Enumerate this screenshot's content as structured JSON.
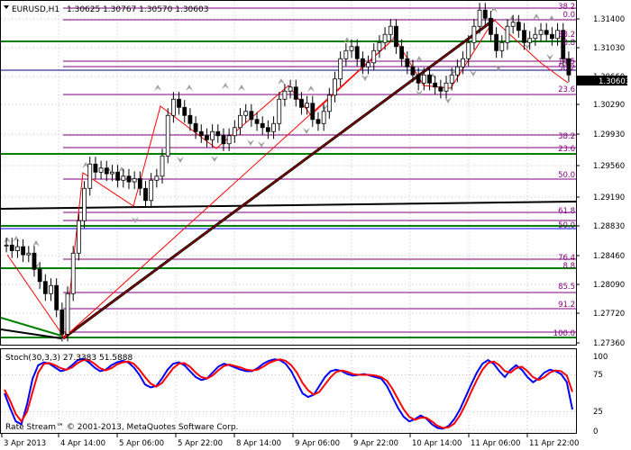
{
  "header": {
    "symbol": "EURUSD,H1",
    "ohlc": "1.30625 1.30767 1.30570 1.30603"
  },
  "indicator": {
    "label": "Stoch(30,3,3) 27.3383 51.5888",
    "levels": [
      "100",
      "75",
      "25",
      "0"
    ],
    "main_values": [
      50,
      30,
      12,
      8,
      35,
      70,
      88,
      92,
      90,
      85,
      80,
      82,
      88,
      95,
      97,
      92,
      85,
      80,
      82,
      88,
      92,
      94,
      92,
      85,
      75,
      62,
      58,
      60,
      70,
      82,
      90,
      92,
      88,
      80,
      72,
      68,
      70,
      78,
      86,
      90,
      88,
      85,
      82,
      80,
      80,
      84,
      90,
      94,
      96,
      95,
      90,
      80,
      65,
      50,
      45,
      48,
      60,
      72,
      80,
      82,
      80,
      76,
      74,
      75,
      76,
      74,
      72,
      70,
      60,
      45,
      30,
      18,
      12,
      15,
      20,
      16,
      8,
      3,
      2,
      6,
      15,
      28,
      45,
      62,
      78,
      90,
      95,
      90,
      80,
      72,
      82,
      88,
      82,
      72,
      65,
      70,
      78,
      82,
      80,
      76,
      65,
      28
    ],
    "signal_values": [
      55,
      40,
      22,
      12,
      25,
      52,
      78,
      90,
      91,
      88,
      84,
      82,
      85,
      91,
      95,
      95,
      90,
      84,
      81,
      84,
      89,
      92,
      93,
      90,
      82,
      72,
      63,
      59,
      64,
      74,
      84,
      90,
      91,
      86,
      78,
      72,
      70,
      74,
      81,
      87,
      89,
      87,
      85,
      82,
      81,
      82,
      86,
      91,
      94,
      96,
      94,
      88,
      78,
      64,
      54,
      48,
      52,
      62,
      72,
      79,
      81,
      79,
      76,
      75,
      75,
      75,
      74,
      72,
      67,
      56,
      42,
      28,
      18,
      14,
      17,
      17,
      12,
      6,
      3,
      4,
      9,
      20,
      35,
      52,
      68,
      82,
      91,
      93,
      88,
      80,
      78,
      84,
      86,
      80,
      72,
      68,
      72,
      78,
      81,
      80,
      74,
      52
    ],
    "colors": {
      "main": "#0000ff",
      "signal": "#ff0000"
    }
  },
  "copyright": "Rate Stream™ © 2001-2013, MetaQuotes Software Corp.",
  "price_axis": {
    "ticks": [
      "1.31400",
      "1.31030",
      "1.30660",
      "1.30290",
      "1.29930",
      "1.29560",
      "1.29190",
      "1.28830",
      "1.28460",
      "1.28090",
      "1.27720",
      "1.27360"
    ],
    "current": "1.30603"
  },
  "time_axis": {
    "ticks": [
      "3 Apr 2013",
      "4 Apr 14:00",
      "5 Apr 06:00",
      "5 Apr 22:00",
      "8 Apr 14:00",
      "9 Apr 06:00",
      "9 Apr 22:00",
      "10 Apr 14:00",
      "11 Apr 06:00",
      "11 Apr 22:00"
    ]
  },
  "fibo_right": {
    "labels": [
      "38.2",
      "0.0",
      "38.2",
      "8.8",
      "14.5",
      "56.2",
      "23.6"
    ]
  },
  "fibo_mid": {
    "labels": [
      "38.2",
      "23.6",
      "50.0",
      "61.8",
      "50.0",
      "76.4",
      "8.8",
      "85.5",
      "91.2",
      "100.0"
    ]
  },
  "candles": [
    1.285,
    1.2843,
    1.2848,
    1.2838,
    1.284,
    1.282,
    1.2805,
    1.279,
    1.28,
    1.277,
    1.274,
    1.279,
    1.284,
    1.288,
    1.292,
    1.295,
    1.294,
    1.2945,
    1.2938,
    1.294,
    1.293,
    1.2935,
    1.2928,
    1.2932,
    1.292,
    1.2905,
    1.293,
    1.2935,
    1.296,
    1.301,
    1.303,
    1.302,
    1.301,
    1.3,
    1.299,
    1.2985,
    1.298,
    1.299,
    1.2985,
    1.2975,
    1.2985,
    1.2995,
    1.301,
    1.3015,
    1.3005,
    1.3,
    1.2995,
    1.299,
    1.3,
    1.303,
    1.304,
    1.3045,
    1.303,
    1.302,
    1.3025,
    1.3005,
    1.3,
    1.3015,
    1.3035,
    1.3055,
    1.308,
    1.309,
    1.3095,
    1.308,
    1.307,
    1.3075,
    1.309,
    1.31,
    1.311,
    1.312,
    1.3095,
    1.308,
    1.307,
    1.306,
    1.305,
    1.306,
    1.305,
    1.3045,
    1.304,
    1.305,
    1.306,
    1.307,
    1.308,
    1.31,
    1.312,
    1.314,
    1.313,
    1.311,
    1.309,
    1.31,
    1.312,
    1.3125,
    1.3115,
    1.31,
    1.3105,
    1.311,
    1.3115,
    1.311,
    1.3105,
    1.3115,
    1.308,
    1.306
  ]
}
